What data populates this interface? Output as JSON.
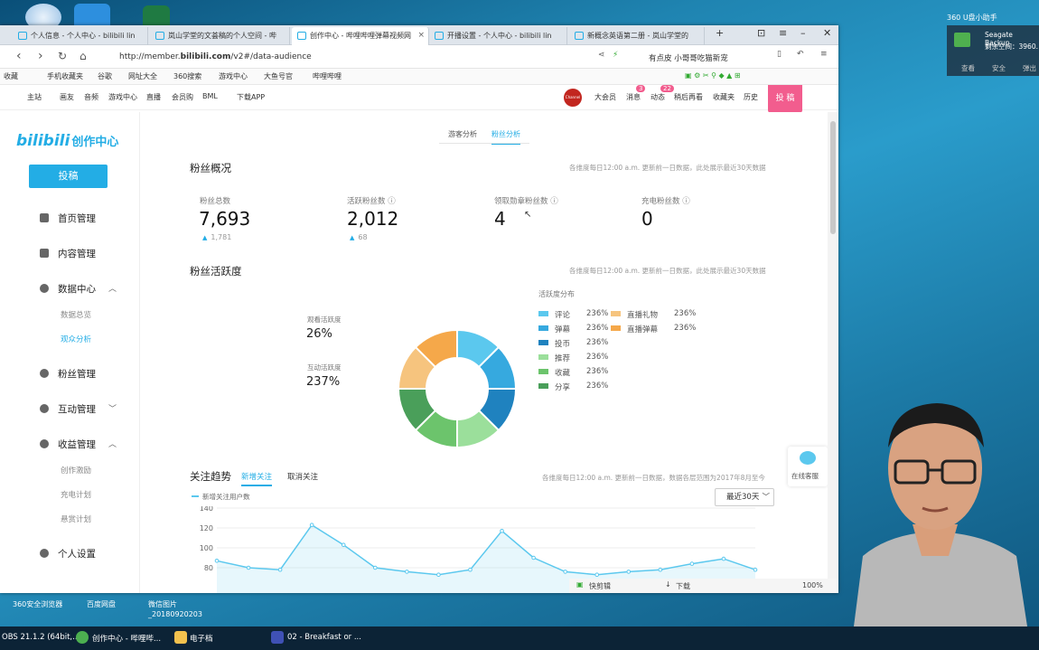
{
  "desktop": {
    "notif_title": "360 U盘小助手",
    "notif_device": "Seagate Backup",
    "notif_free": "剩余空间：3960.",
    "notif_btns": [
      "查看",
      "安全",
      "弹出"
    ],
    "icons": [
      "360安全浏览器",
      "百度网盘",
      "微信图片_20180920203"
    ]
  },
  "browser": {
    "tabs": [
      {
        "label": "个人信息 - 个人中心 - bilibili lin",
        "active": false
      },
      {
        "label": "岚山学堂的文荟稿的个人空间 - 哔",
        "active": false
      },
      {
        "label": "创作中心 - 哔哩哔哩弹幕视频网",
        "active": true
      },
      {
        "label": "开播设置 - 个人中心 - bilibili lin",
        "active": false
      },
      {
        "label": "新概念英语第二册 - 岚山学堂的",
        "active": false
      }
    ],
    "url_prefix": "http://member.",
    "url_host": "bilibili.com",
    "url_path": "/v2#/data-audience",
    "search_hint": "有点皮 小哥哥吃猫新宠",
    "bookmarks": [
      "收藏",
      "手机收藏夹",
      "谷歌",
      "网址大全",
      "360搜索",
      "游戏中心",
      "大鱼号官",
      "哔哩哔哩"
    ]
  },
  "topnav": {
    "left": [
      "主站",
      "画友",
      "音频",
      "游戏中心",
      "直播",
      "会员购",
      "BML",
      "下载APP"
    ],
    "avatar_text": "Channel",
    "right": [
      "大会员",
      "消息",
      "动态",
      "稍后再看",
      "收藏夹",
      "历史"
    ],
    "badge_msg": "3",
    "badge_dyn": "22",
    "post": "投 稿"
  },
  "sidebar": {
    "logo": "bilibili",
    "logo_sub": "创作中心",
    "post_btn": "投稿",
    "items": [
      "首页管理",
      "内容管理",
      "数据中心",
      "粉丝管理",
      "互动管理",
      "收益管理",
      "个人设置"
    ],
    "data_subs": [
      "数据总览",
      "观众分析"
    ],
    "income_subs": [
      "创作激励",
      "充电计划",
      "悬赏计划"
    ]
  },
  "tabs": [
    "游客分析",
    "粉丝分析"
  ],
  "overview": {
    "title": "粉丝概况",
    "note": "各维度每日12:00 a.m. 更新前一日数据，此处展示最近30天数据",
    "stats": [
      {
        "label": "粉丝总数",
        "value": "7,693",
        "delta": "1,781"
      },
      {
        "label": "活跃粉丝数",
        "value": "2,012",
        "delta": "68"
      },
      {
        "label": "领取勋章粉丝数",
        "value": "4",
        "delta": ""
      },
      {
        "label": "充电粉丝数",
        "value": "0",
        "delta": ""
      }
    ]
  },
  "activity": {
    "title": "粉丝活跃度",
    "note": "各维度每日12:00 a.m. 更新前一日数据，此处展示最近30天数据",
    "watch_label": "观看活跃度",
    "watch_value": "26%",
    "inter_label": "互动活跃度",
    "inter_value": "237%",
    "legend_title": "活跃度分布",
    "legend": [
      {
        "name": "评论",
        "value": "236%",
        "color": "#5bc8ee"
      },
      {
        "name": "弹幕",
        "value": "236%",
        "color": "#36a9df"
      },
      {
        "name": "投币",
        "value": "236%",
        "color": "#1f82bf"
      },
      {
        "name": "推荐",
        "value": "236%",
        "color": "#9bdf9b"
      },
      {
        "name": "收藏",
        "value": "236%",
        "color": "#6cc46c"
      },
      {
        "name": "分享",
        "value": "236%",
        "color": "#4a9f5a"
      },
      {
        "name": "直播礼物",
        "value": "236%",
        "color": "#f6c47e"
      },
      {
        "name": "直播弹幕",
        "value": "236%",
        "color": "#f5a84a"
      }
    ]
  },
  "trend": {
    "title": "关注趋势",
    "tab_new": "新增关注",
    "tab_unfollow": "取消关注",
    "note": "各维度每日12:00 a.m. 更新前一日数据，数据各层范围为2017年8月至今",
    "select": "最近30天",
    "service": "在线客服"
  },
  "chart_data": {
    "type": "line",
    "series": [
      {
        "name": "新增关注用户数",
        "values": [
          87,
          80,
          78,
          123,
          103,
          80,
          76,
          73,
          78,
          117,
          90,
          76,
          73,
          76,
          78,
          84,
          89,
          78
        ]
      }
    ],
    "y_ticks": [
      "140",
      "120",
      "100",
      "80"
    ],
    "ylim": [
      75,
      140
    ],
    "grid": true
  },
  "statusbar": {
    "items": [
      "快剪辑",
      "下载"
    ],
    "zoom": "100%"
  },
  "taskbar": {
    "items": [
      "OBS 21.1.2 (64bit,...",
      "创作中心 - 哔哩哔...",
      "电子档",
      "02 - Breakfast or ..."
    ]
  }
}
